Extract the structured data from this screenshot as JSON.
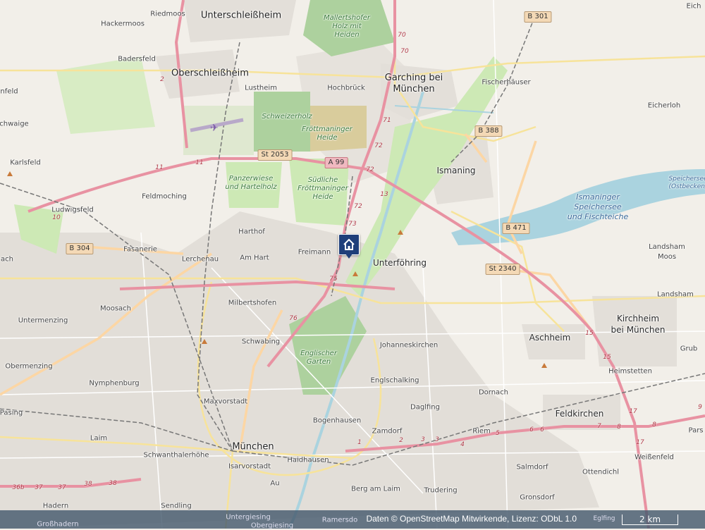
{
  "colors": {
    "land": "#f2efe9",
    "urban": "#e4e0dc",
    "park": "#cde9b5",
    "forest": "#add19e",
    "water": "#aad3df",
    "motorway": "#e892a2",
    "primary": "#fcd6a4",
    "secondary": "#f7fabf",
    "rail": "#777777",
    "marker": "#1f3f7a",
    "attribution_bg": "#465a6e"
  },
  "labels": {
    "riedmoos": "Riedmoos",
    "unterschleissheim": "Unterschleißheim",
    "hackermoos": "Hackermoos",
    "badersfeld": "Badersfeld",
    "oberschleissheim": "Oberschleißheim",
    "lustheim": "Lustheim",
    "hochbrueck": "Hochbrück",
    "garching": "Garching bei\nMünchen",
    "fischerhaeuser": "Fischerhäuser",
    "eicherloh": "Eicherloh",
    "eich": "Eich",
    "nfeld": "nfeld",
    "chwaige": "chwaige",
    "karlsfeld": "Karlsfeld",
    "ismaning": "Ismaning",
    "feldmoching": "Feldmoching",
    "ludwigsfeld": "Ludwigsfeld",
    "harthof": "Harthof",
    "freimann": "Freimann",
    "fasanerie": "Fasanerie",
    "lerchenau": "Lerchenau",
    "am_hart": "Am Hart",
    "unterfoehring": "Unterföhring",
    "landsham_moos": "Landsham\nMoos",
    "landsham": "Landsham",
    "ach": "ach",
    "moosach": "Moosach",
    "milbertshofen": "Milbertshofen",
    "kirchheim": "Kirchheim\nbei München",
    "untermenzing": "Untermenzing",
    "schwabing": "Schwabing",
    "johanneskirchen": "Johanneskirchen",
    "aschheim": "Aschheim",
    "grub": "Grub",
    "obermenzing": "Obermenzing",
    "heimstetten": "Heimstetten",
    "nymphenburg": "Nymphenburg",
    "englschalking": "Englschalking",
    "dornach": "Dornach",
    "maxvorstadt": "Maxvorstadt",
    "daglfing": "Daglfing",
    "feldkirchen": "Feldkirchen",
    "pasing": "Pasing",
    "bogenhausen": "Bogenhausen",
    "zamdorf": "Zamdorf",
    "riem": "Riem",
    "pars": "Pars",
    "laim": "Laim",
    "muenchen": "München",
    "schwanthalerhoehe": "Schwanthalerhöhe",
    "weissenfeld": "Weißenfeld",
    "haidhausen": "Haidhausen",
    "isarvorstadt": "Isarvorstadt",
    "salmdorf": "Salmdorf",
    "ottendichl": "Ottendichl",
    "au": "Au",
    "berg_am_laim": "Berg am Laim",
    "trudering": "Trudering",
    "gronsdorf": "Gronsdorf",
    "hadern": "Hadern",
    "sendling": "Sendling",
    "grosshadern": "Großhadern",
    "untergiesing": "Untergiesing",
    "ramersdorf": "Ramersdo",
    "obergiesing": "Obergiesing",
    "egling": "Eglfing"
  },
  "park_labels": {
    "mallertshofer": "Mallertshofer\nHolz mit\nHeiden",
    "schweizerholz": "Schweizerholz",
    "froettmaninger_heide": "Fröttmaninger\nHeide",
    "panzerwiese": "Panzerwiese\nund Hartelholz",
    "suedliche": "Südliche\nFröttmaninger\nHeide",
    "englischer_garten": "Englischer\nGarten"
  },
  "water_labels": {
    "speichersee": "Ismaninger\nSpeichersee\nund Fischteiche",
    "ostbecken": "Speichersee\n(Ostbecken)"
  },
  "road_shields": {
    "b301": "B 301",
    "st2053": "St 2053",
    "a99": "A 99",
    "b388": "B 388",
    "b471": "B 471",
    "b304": "B 304",
    "st2340": "St 2340"
  },
  "route_numbers": {
    "r70a": "70",
    "r70b": "70",
    "r71": "71",
    "r72a": "72",
    "r72b": "72",
    "r72c": "72",
    "r73": "73",
    "r13": "13",
    "r75": "75",
    "r76": "76",
    "r11a": "11",
    "r11b": "11",
    "r10": "10",
    "r2": "2",
    "r15a": "15",
    "r15b": "15",
    "r17a": "17",
    "r17b": "17",
    "r8a": "8",
    "r8b": "8",
    "r7": "7",
    "r6a": "6",
    "r6b": "6",
    "r5": "5",
    "r4": "4",
    "r3a": "3",
    "r3b": "3",
    "r2b": "2",
    "r1": "1",
    "r36b": "36b",
    "r37a": "37",
    "r37b": "37",
    "r38a": "38",
    "r38b": "38",
    "r9": "9"
  },
  "marker": {
    "icon": "home-icon",
    "label": "Home location"
  },
  "attribution": "Daten © OpenStreetMap Mitwirkende, Lizenz: ODbL 1.0",
  "scale_label": "2 km"
}
